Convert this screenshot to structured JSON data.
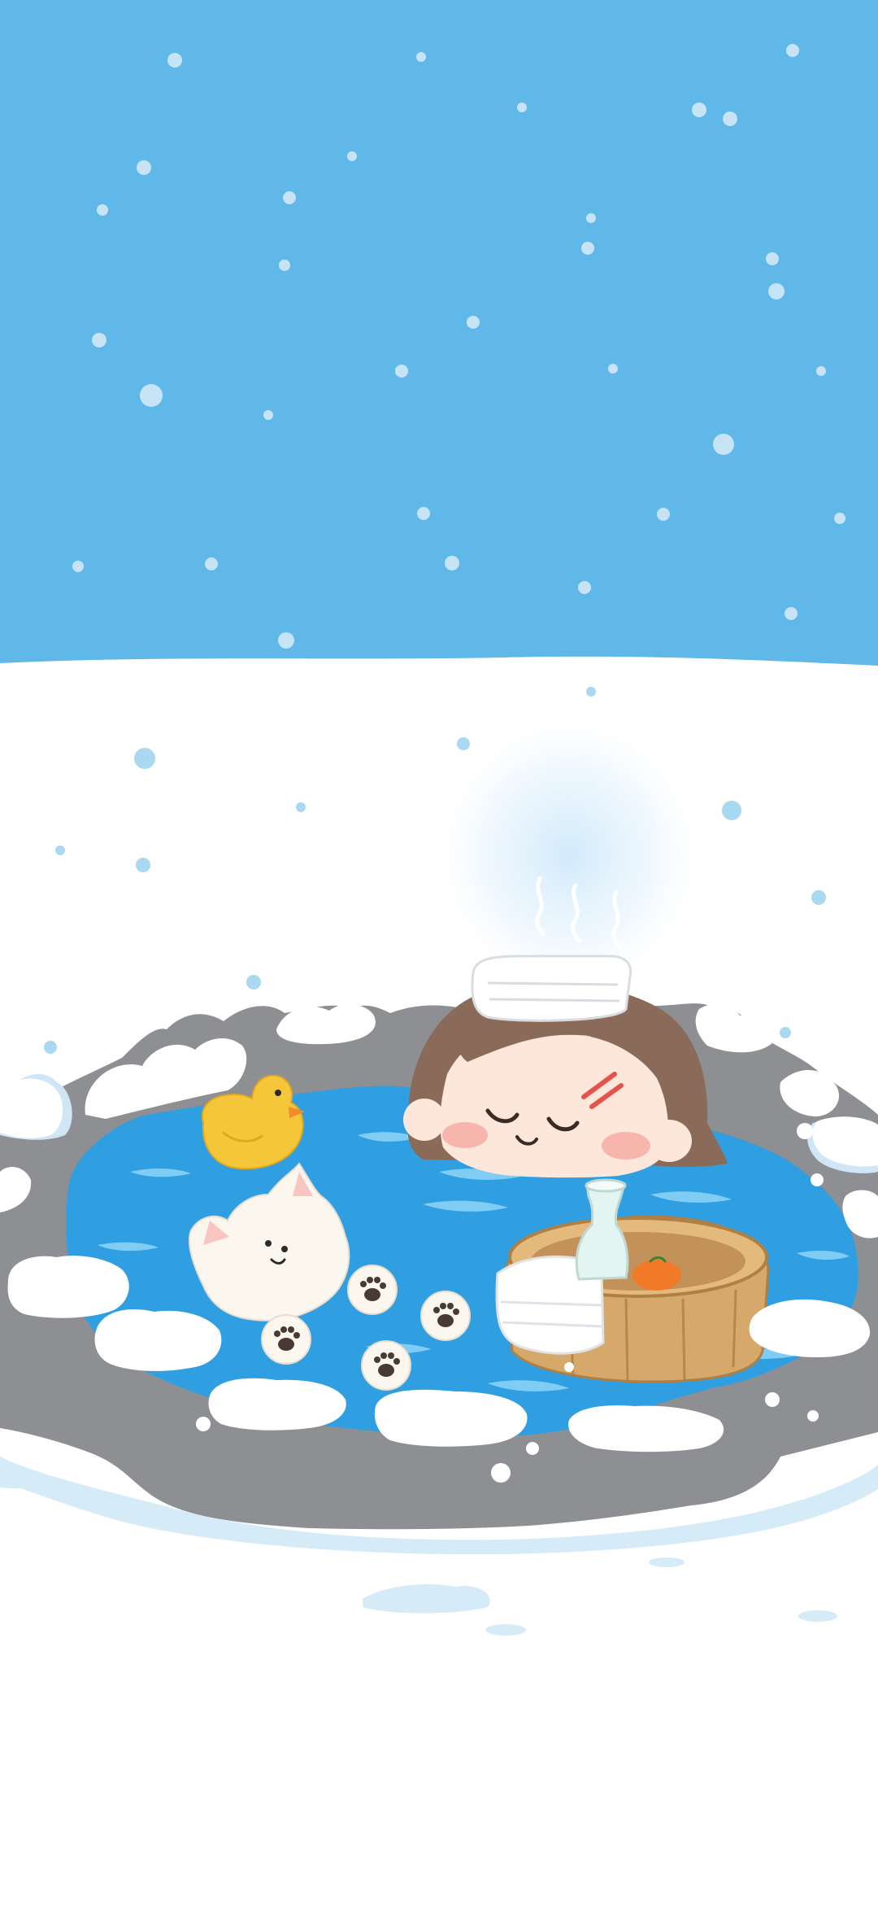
{
  "scene": {
    "kind": "illustration",
    "subject": "girl-bathing-in-snowy-hot-spring",
    "elements": [
      "sky",
      "snowfall",
      "snow-field",
      "rock-rim",
      "hot-spring-water",
      "girl",
      "towel-on-head",
      "steam",
      "rubber-duck",
      "white-cat",
      "paw-pads",
      "wooden-tub",
      "sake-bottle",
      "orange"
    ]
  },
  "colors": {
    "sky": "#5fb8e8",
    "snow": "#ffffff",
    "snow_shadow": "#d6ebf8",
    "rock": "#8e8f93",
    "water": "#2f9fe2",
    "water_highlight": "#7fcdf5",
    "hair": "#8a6a58",
    "skin": "#fde6da",
    "blush": "#f6a9a3",
    "duck": "#f5c63a",
    "tub": "#d6a86a",
    "orange": "#f07a28",
    "bottle": "#e4f4f0"
  },
  "icons": [
    "snowflake-icon",
    "steam-icon",
    "rubber-duck-icon",
    "cat-icon",
    "paw-icon",
    "hairpin-icon",
    "orange-icon"
  ]
}
